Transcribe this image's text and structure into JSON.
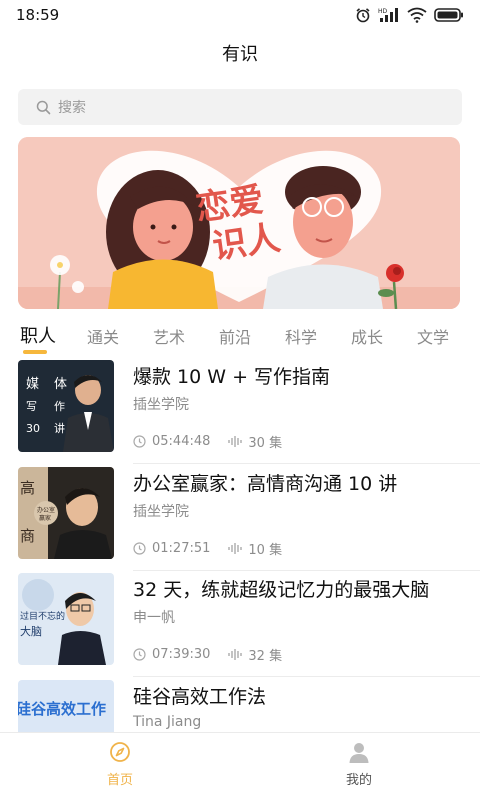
{
  "status_bar": {
    "time": "18:59",
    "network": "HD"
  },
  "header": {
    "title": "有识"
  },
  "search": {
    "placeholder": "搜索"
  },
  "banner": {
    "headline_line1": "恋爱",
    "headline_line2": "识人"
  },
  "tabs": [
    {
      "label": "职人",
      "active": true
    },
    {
      "label": "通关"
    },
    {
      "label": "艺术"
    },
    {
      "label": "前沿"
    },
    {
      "label": "科学"
    },
    {
      "label": "成长"
    },
    {
      "label": "文学"
    }
  ],
  "courses": [
    {
      "title": "爆款 10 W + 写作指南",
      "author": "插坐学院",
      "duration": "05:44:48",
      "episodes": "30 集",
      "thumb_text": [
        "媒",
        "体",
        "写",
        "作",
        "30",
        "讲"
      ]
    },
    {
      "title": "办公室赢家：高情商沟通 10 讲",
      "author": "插坐学院",
      "duration": "01:27:51",
      "episodes": "10 集",
      "thumb_text": [
        "高",
        "商",
        "办公室",
        "赢家"
      ]
    },
    {
      "title": "32 天，练就超级记忆力的最强大脑",
      "author": "申一帆",
      "duration": "07:39:30",
      "episodes": "32 集",
      "thumb_text": [
        "过目不忘的",
        "大脑"
      ]
    },
    {
      "title": "硅谷高效工作法",
      "author": "Tina Jiang",
      "duration": "",
      "episodes": "",
      "thumb_text": [
        "硅谷高效工作"
      ]
    }
  ],
  "bottom_nav": [
    {
      "label": "首页",
      "icon": "compass-icon",
      "active": true
    },
    {
      "label": "我的",
      "icon": "user-icon",
      "active": false
    }
  ],
  "colors": {
    "accent": "#f6b73c",
    "nav_active": "#f0b34a",
    "banner_bg": "#f6c9bd",
    "search_bg": "#f2f2f2"
  }
}
